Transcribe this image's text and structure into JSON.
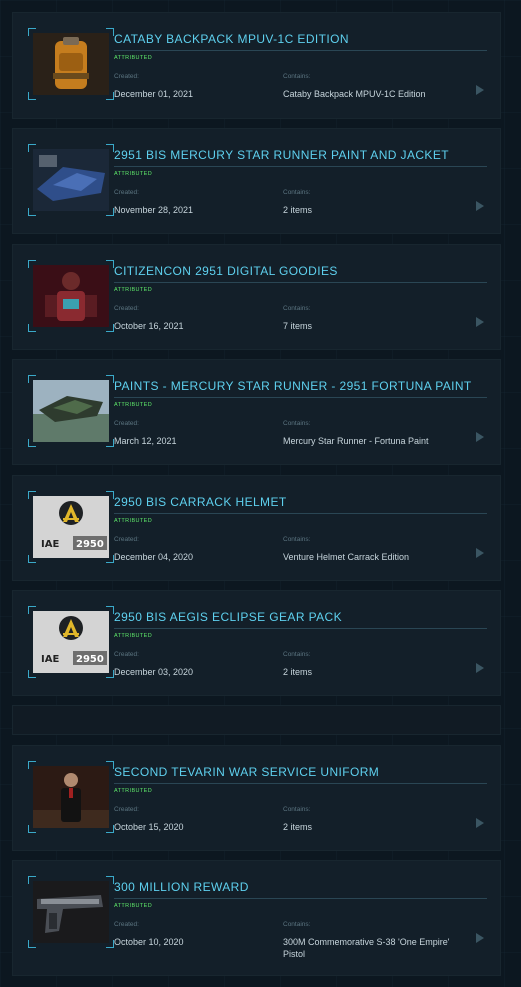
{
  "items": [
    {
      "title": "CATABY BACKPACK MPUV-1C EDITION",
      "status": "ATTRIBUTED",
      "created_label": "Created:",
      "created": "December 01, 2021",
      "contains_label": "Contains:",
      "contains": "Cataby Backpack MPUV-1C Edition",
      "thumb": "backpack-image"
    },
    {
      "title": "2951 BIS MERCURY STAR RUNNER PAINT AND JACKET",
      "status": "ATTRIBUTED",
      "created_label": "Created:",
      "created": "November 28, 2021",
      "contains_label": "Contains:",
      "contains": "2 items",
      "thumb": "ship-paint-image"
    },
    {
      "title": "CITIZENCON 2951 DIGITAL GOODIES",
      "status": "ATTRIBUTED",
      "created_label": "Created:",
      "created": "October 16, 2021",
      "contains_label": "Contains:",
      "contains": "7 items",
      "thumb": "armor-character-image"
    },
    {
      "title": "PAINTS - MERCURY STAR RUNNER - 2951 FORTUNA PAINT",
      "status": "ATTRIBUTED",
      "created_label": "Created:",
      "created": "March 12, 2021",
      "contains_label": "Contains:",
      "contains": "Mercury Star Runner - Fortuna Paint",
      "thumb": "ship-image"
    },
    {
      "title": "2950 BIS CARRACK HELMET",
      "status": "ATTRIBUTED",
      "created_label": "Created:",
      "created": "December 04, 2020",
      "contains_label": "Contains:",
      "contains": "Venture Helmet Carrack Edition",
      "thumb": "iae-logo",
      "logo_text_a": "IAE",
      "logo_text_b": "2950"
    },
    {
      "title": "2950 BIS AEGIS ECLIPSE GEAR PACK",
      "status": "ATTRIBUTED",
      "created_label": "Created:",
      "created": "December 03, 2020",
      "contains_label": "Contains:",
      "contains": "2 items",
      "thumb": "iae-logo",
      "logo_text_a": "IAE",
      "logo_text_b": "2950"
    },
    {
      "title": "SECOND TEVARIN WAR SERVICE UNIFORM",
      "status": "ATTRIBUTED",
      "created_label": "Created:",
      "created": "October 15, 2020",
      "contains_label": "Contains:",
      "contains": "2 items",
      "thumb": "uniform-character-image"
    },
    {
      "title": "300 MILLION REWARD",
      "status": "ATTRIBUTED",
      "created_label": "Created:",
      "created": "October 10, 2020",
      "contains_label": "Contains:",
      "contains": "300M Commemorative S-38 'One Empire' Pistol",
      "thumb": "pistol-image"
    }
  ],
  "colors": {
    "title": "#5ed0ee",
    "status": "#5ee86a",
    "card": "#131f29",
    "background": "#0c1720"
  }
}
